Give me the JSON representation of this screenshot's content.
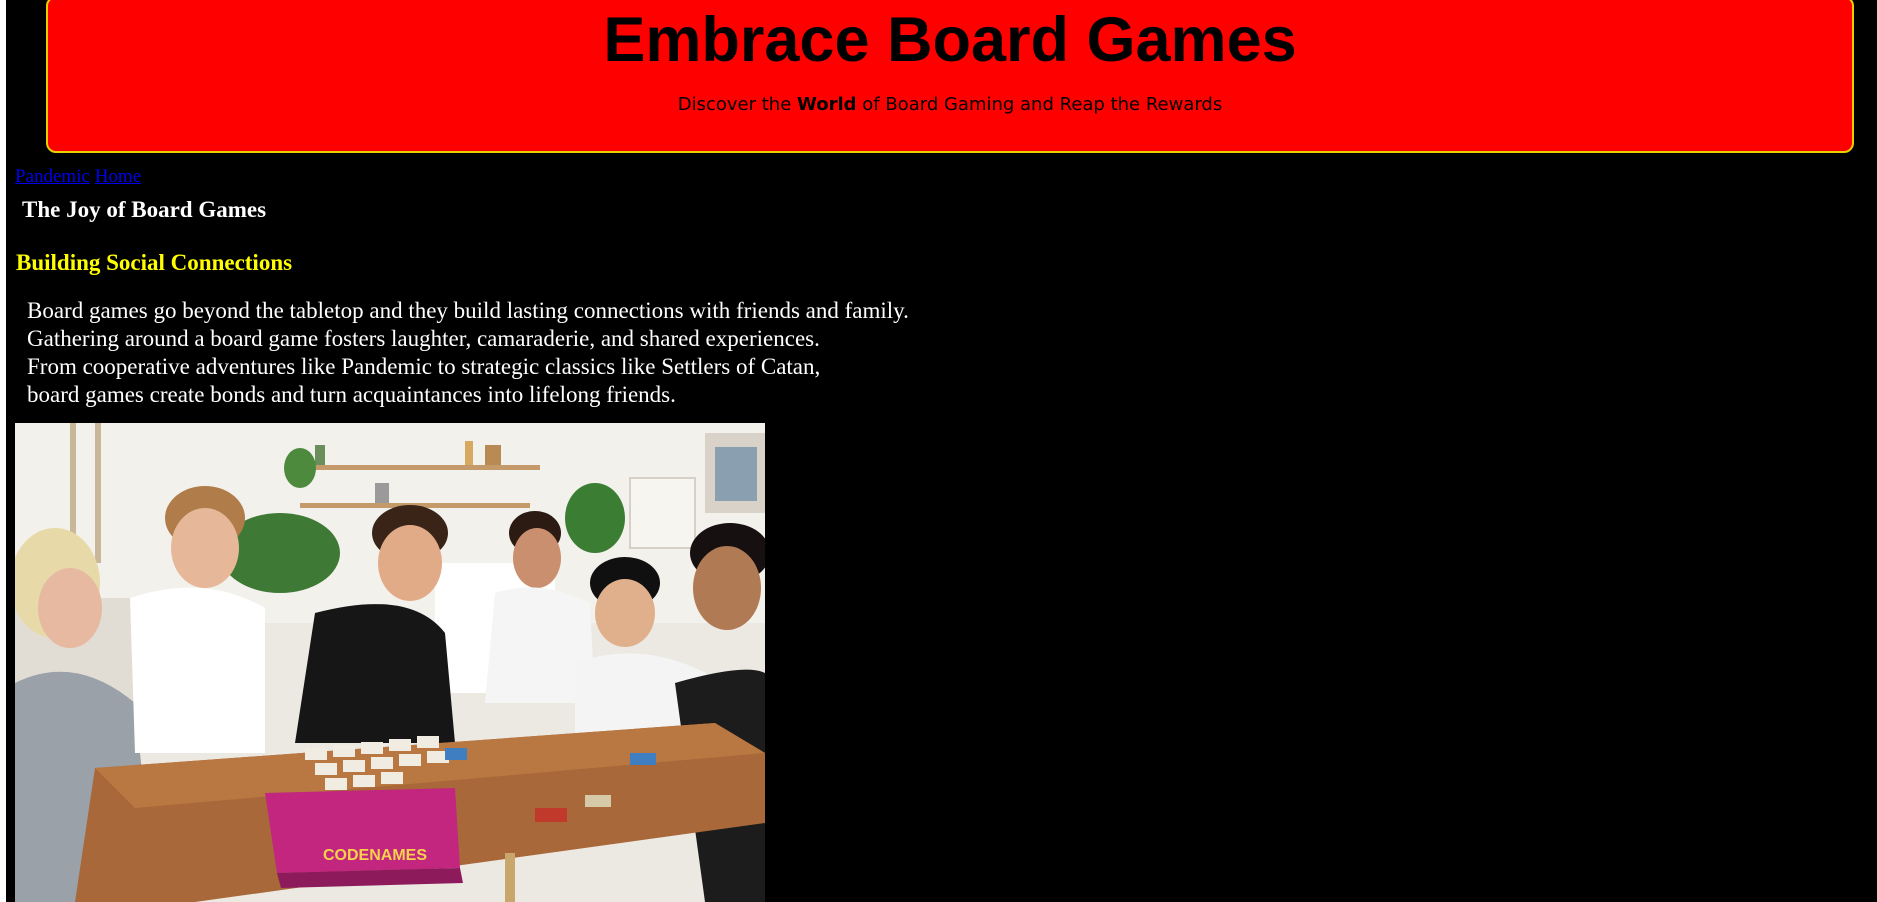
{
  "header": {
    "title": "Embrace Board Games",
    "subtitle_before": "Discover the",
    "subtitle_emphasis": "World",
    "subtitle_after": "of Board Gaming and Reap the Rewards"
  },
  "nav": {
    "links": [
      "Pandemic",
      "Home"
    ]
  },
  "main": {
    "heading": "The Joy of Board Games",
    "subheading": "Building Social Connections",
    "paragraph_lines": [
      "Board games go beyond the tabletop and they build lasting connections with friends and family.",
      "Gathering around a board game fosters laughter, camaraderie, and shared experiences.",
      "From cooperative adventures like Pandemic to strategic classics like Settlers of Catan,",
      "board games create bonds and turn acquaintances into lifelong friends."
    ],
    "photo": {
      "box_brand": "CODENAMES"
    }
  },
  "colors": {
    "page_background": "#000000",
    "banner_background": "#ff0000",
    "banner_border": "#e8d000",
    "heading": "#ffffff",
    "subheading": "#ffff00",
    "link": "#0000ee"
  }
}
